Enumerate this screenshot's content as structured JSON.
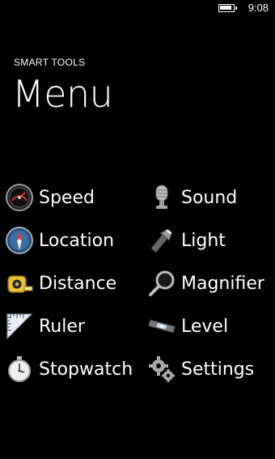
{
  "status": {
    "time": "9:08"
  },
  "header": {
    "app_name": "SMART TOOLS",
    "page_title": "Menu"
  },
  "menu": {
    "speed": "Speed",
    "sound": "Sound",
    "location": "Location",
    "light": "Light",
    "distance": "Distance",
    "magnifier": "Magnifier",
    "ruler": "Ruler",
    "level": "Level",
    "stopwatch": "Stopwatch",
    "settings": "Settings"
  }
}
